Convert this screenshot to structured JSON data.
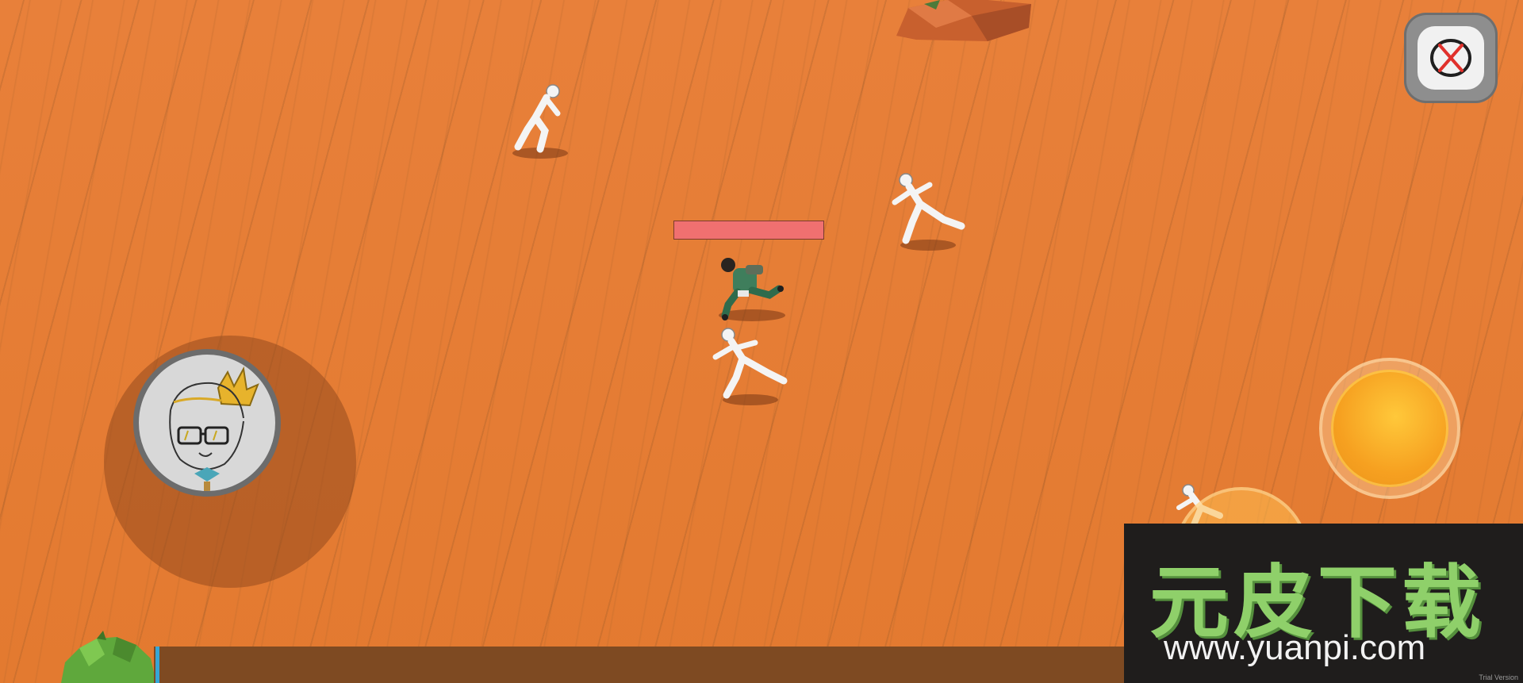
{
  "hud": {
    "close_button_icon": "close-x-icon",
    "player_health_fraction": 1.0,
    "joystick_avatar_icon": "crowned-boy-avatar-icon",
    "attack_button_icon": "orange-orb-icon",
    "skill_button_icon": "orange-orb-icon"
  },
  "watermark": {
    "title": "元皮下载",
    "url": "www.yuanpi.com",
    "trial_text": "Trial Version"
  },
  "colors": {
    "ground": "#e67d33",
    "health_bar": "#f07070",
    "attack_button": "#f6a020",
    "watermark_green": "#8fd06a"
  }
}
